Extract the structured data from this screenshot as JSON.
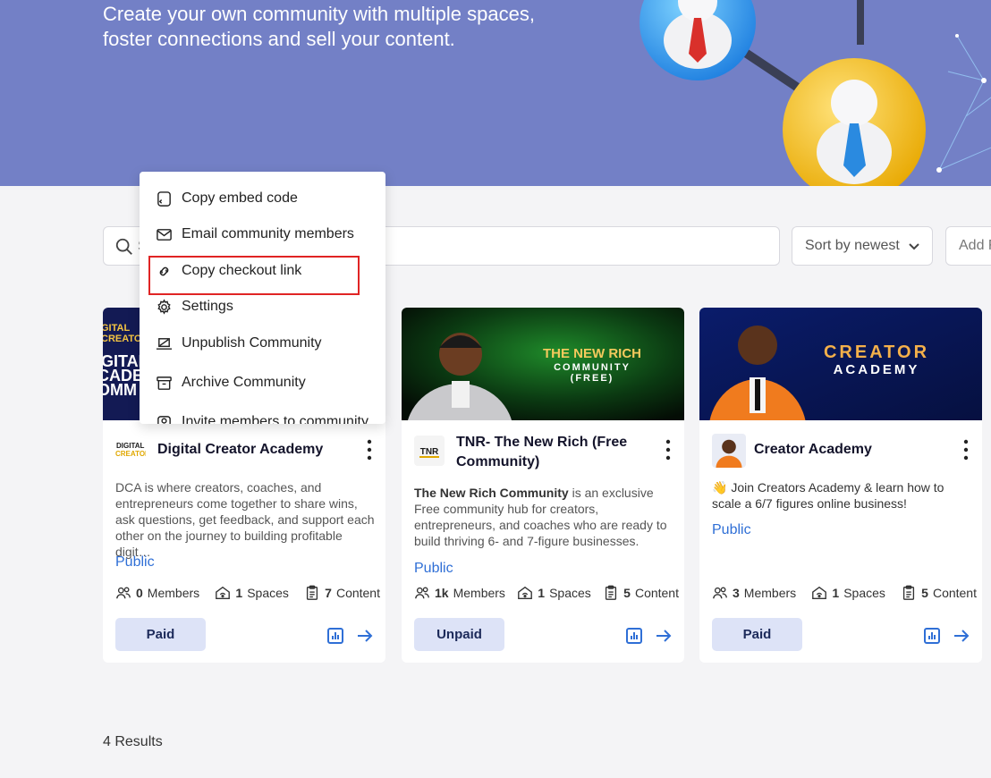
{
  "hero": {
    "tagline_line1": "Create your own community with multiple spaces,",
    "tagline_line2": "foster connections and sell your content."
  },
  "toolbar": {
    "search_placeholder": "S",
    "sort_label": "Sort by newest",
    "add_label": "Add F"
  },
  "menu": {
    "items": [
      {
        "label": "Copy embed code",
        "icon": "embed-icon"
      },
      {
        "label": "Email community members",
        "icon": "mail-icon"
      },
      {
        "label": "Copy checkout link",
        "icon": "link-icon"
      },
      {
        "label": "Settings",
        "icon": "gear-icon"
      },
      {
        "label": "Unpublish Community",
        "icon": "laptop-icon"
      },
      {
        "label": "Archive Community",
        "icon": "archive-icon"
      },
      {
        "label": "Invite members to community",
        "icon": "invite-icon"
      }
    ],
    "highlighted_item": "Copy checkout link"
  },
  "cards": [
    {
      "title": "Digital Creator Academy",
      "banner_text": [
        "GITAL",
        "CADE",
        "OMM"
      ],
      "banner_small": [
        "GITAL",
        "CREATOR",
        "ADEMY"
      ],
      "logo_text": "DIGITAL CREATOR",
      "description": "DCA is where creators, coaches, and entrepreneurs come together to share wins, ask questions, get feedback, and support each other on the journey to building profitable digit…",
      "visibility": "Public",
      "members_count": "0",
      "members_label": "Members",
      "spaces_count": "1",
      "spaces_label": "Spaces",
      "content_count": "7",
      "content_label": "Content",
      "price_badge": "Paid"
    },
    {
      "title": "TNR- The New Rich (Free Community)",
      "banner_line1": "THE NEW RICH",
      "banner_line2": "COMMUNITY",
      "banner_line3": "(FREE)",
      "logo_text": "TNR",
      "description_bold": "The New Rich Community",
      "description": " is an exclusive Free community hub for creators, entrepreneurs, and coaches who are ready to build thriving 6- and 7-figure businesses.",
      "visibility": "Public",
      "members_count": "1k",
      "members_label": "Members",
      "spaces_count": "1",
      "spaces_label": "Spaces",
      "content_count": "5",
      "content_label": "Content",
      "price_badge": "Unpaid"
    },
    {
      "title": "Creator Academy",
      "banner_line1": "CREATOR",
      "banner_line2": "ACADEMY",
      "description": "👋 Join Creators Academy & learn how to scale a 6/7 figures online business!",
      "visibility": "Public",
      "members_count": "3",
      "members_label": "Members",
      "spaces_count": "1",
      "spaces_label": "Spaces",
      "content_count": "5",
      "content_label": "Content",
      "price_badge": "Paid"
    }
  ],
  "results_label": "4 Results",
  "colors": {
    "hero_bg": "#7380c6",
    "accent_blue": "#2f6fd6",
    "badge_bg": "#dde3f7",
    "highlight_red": "#e02424"
  }
}
